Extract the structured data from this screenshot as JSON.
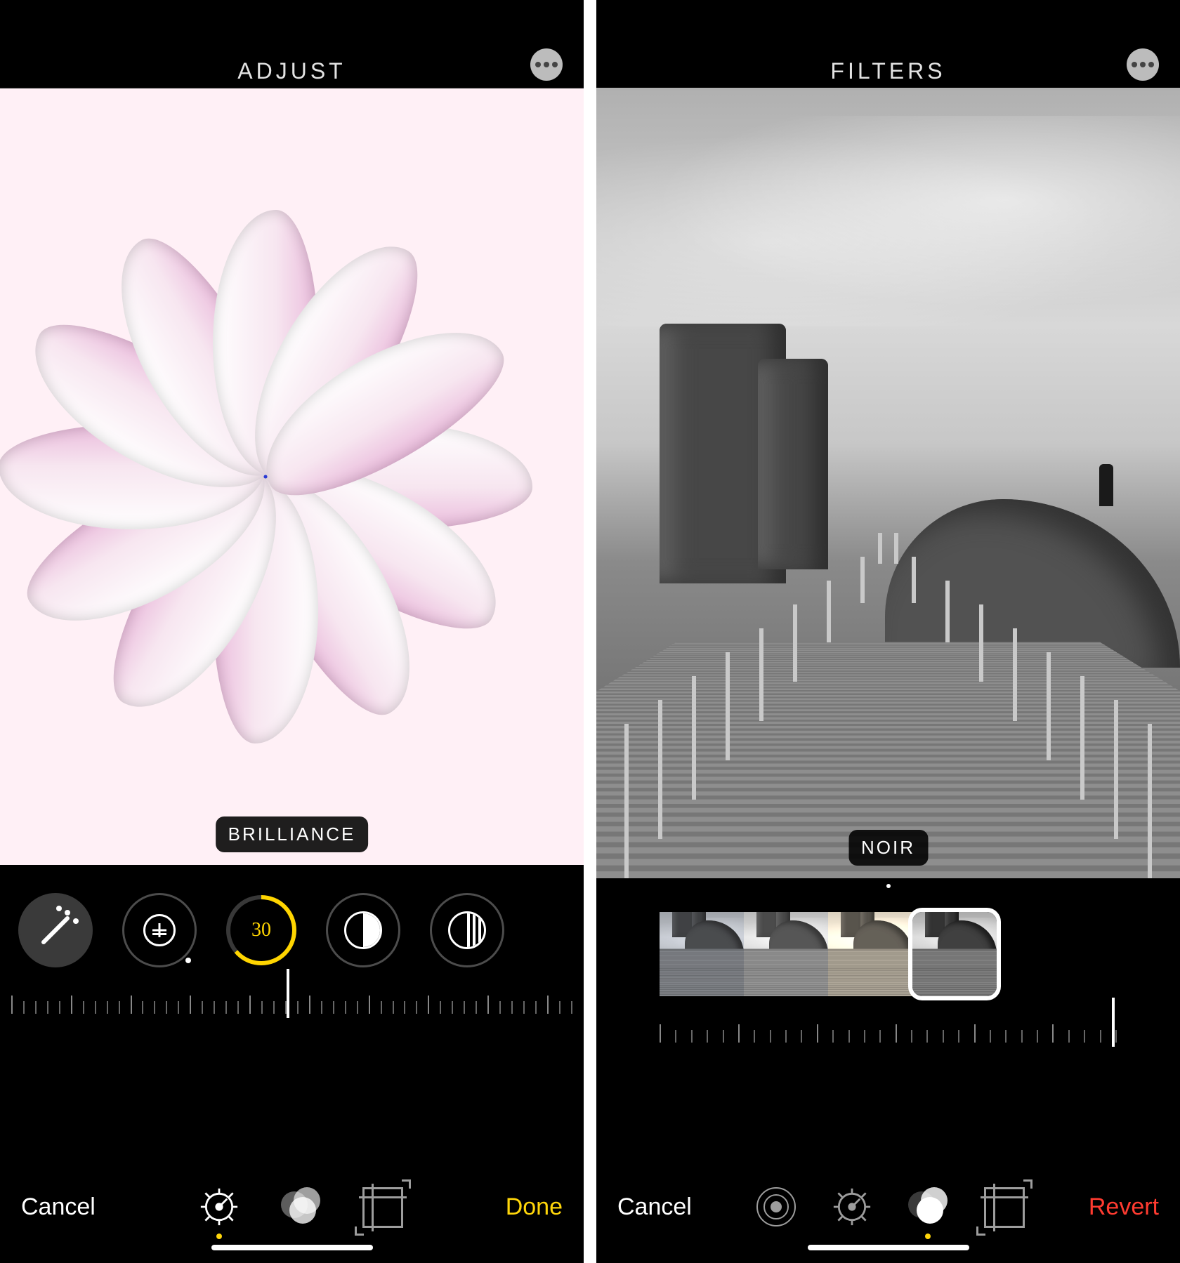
{
  "left": {
    "header": {
      "title": "ADJUST"
    },
    "badge": "BRILLIANCE",
    "tools": {
      "auto_label": "auto-enhance",
      "exposure_label": "exposure",
      "brilliance_value": "30",
      "highlights_label": "highlights",
      "shadows_label": "shadows"
    },
    "bottom": {
      "cancel": "Cancel",
      "done": "Done",
      "modes": [
        "adjust",
        "filters",
        "crop"
      ],
      "active_mode": "adjust"
    }
  },
  "right": {
    "header": {
      "title": "FILTERS"
    },
    "badge": "NOIR",
    "filters_visible": [
      "dramatic-cool",
      "mono",
      "silvertone",
      "noir"
    ],
    "selected_filter": "noir",
    "bottom": {
      "cancel": "Cancel",
      "revert": "Revert",
      "modes": [
        "live-photo",
        "adjust",
        "filters",
        "crop"
      ],
      "active_mode": "filters"
    }
  }
}
